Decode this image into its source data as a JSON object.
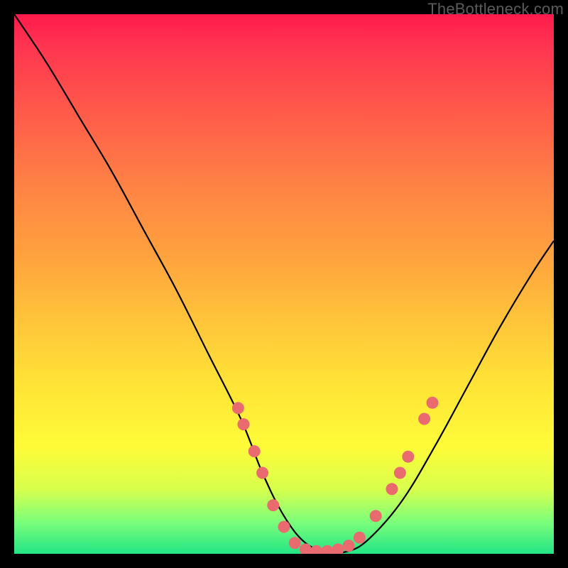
{
  "watermark": "TheBottleneck.com",
  "chart_data": {
    "type": "line",
    "title": "",
    "xlabel": "",
    "ylabel": "",
    "xlim": [
      0,
      100
    ],
    "ylim": [
      0,
      100
    ],
    "series": [
      {
        "name": "curve",
        "x": [
          0,
          6,
          12,
          18,
          24,
          30,
          36,
          42,
          46,
          50,
          54,
          58,
          62,
          66,
          72,
          78,
          84,
          90,
          96,
          100
        ],
        "y": [
          100,
          91,
          81,
          71,
          60,
          49,
          37,
          25,
          15,
          7,
          2,
          0.5,
          0.5,
          3,
          10,
          20,
          31,
          42,
          52,
          58
        ]
      }
    ],
    "markers": [
      {
        "x": 41.5,
        "y": 27
      },
      {
        "x": 42.5,
        "y": 24
      },
      {
        "x": 44.5,
        "y": 19
      },
      {
        "x": 46.0,
        "y": 15
      },
      {
        "x": 48.0,
        "y": 9
      },
      {
        "x": 50.0,
        "y": 5
      },
      {
        "x": 52.0,
        "y": 2
      },
      {
        "x": 54.0,
        "y": 0.8
      },
      {
        "x": 56.0,
        "y": 0.5
      },
      {
        "x": 58.0,
        "y": 0.5
      },
      {
        "x": 60.0,
        "y": 0.8
      },
      {
        "x": 62.0,
        "y": 1.5
      },
      {
        "x": 64.0,
        "y": 3
      },
      {
        "x": 67.0,
        "y": 7
      },
      {
        "x": 70.0,
        "y": 12
      },
      {
        "x": 71.5,
        "y": 15
      },
      {
        "x": 73.0,
        "y": 18
      },
      {
        "x": 76.0,
        "y": 25
      },
      {
        "x": 77.5,
        "y": 28
      }
    ],
    "gradient_stops": [
      {
        "pos": 0.0,
        "color": "#ff1a4d"
      },
      {
        "pos": 0.18,
        "color": "#ff5a4a"
      },
      {
        "pos": 0.44,
        "color": "#ffa03e"
      },
      {
        "pos": 0.68,
        "color": "#ffe236"
      },
      {
        "pos": 0.88,
        "color": "#d8ff4c"
      },
      {
        "pos": 1.0,
        "color": "#22e585"
      }
    ]
  }
}
